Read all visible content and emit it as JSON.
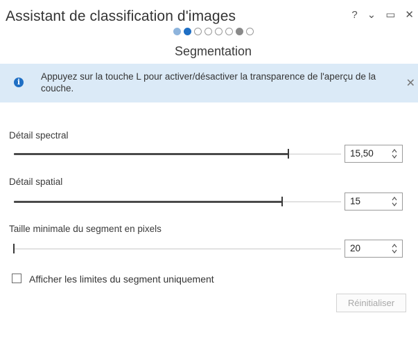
{
  "window": {
    "title": "Assistant de classification d'images",
    "help_glyph": "?",
    "menu_glyph": "⌄",
    "maximize_glyph": "▭",
    "close_glyph": "✕"
  },
  "wizard": {
    "step_states": [
      "done",
      "current",
      "todo",
      "todo",
      "todo",
      "todo",
      "gray",
      "todo"
    ],
    "current_step_title": "Segmentation"
  },
  "info_banner": {
    "icon": "info-icon",
    "text": "Appuyez sur la touche L pour activer/désactiver la transparence de l'aperçu de la couche.",
    "close_glyph": "✕"
  },
  "parameters": {
    "spectral_detail": {
      "label": "Détail spectral",
      "value": "15,50",
      "fraction": 0.84
    },
    "spatial_detail": {
      "label": "Détail spatial",
      "value": "15",
      "fraction": 0.82
    },
    "min_segment_size": {
      "label": "Taille minimale du segment en pixels",
      "value": "20",
      "fraction": 0.0
    }
  },
  "options": {
    "show_boundaries_only": {
      "label": "Afficher les limites du segment uniquement",
      "checked": false
    }
  },
  "actions": {
    "reset_label": "Réinitialiser"
  },
  "colors": {
    "accent": "#1f6fc4",
    "banner_bg": "#dbeaf7"
  }
}
